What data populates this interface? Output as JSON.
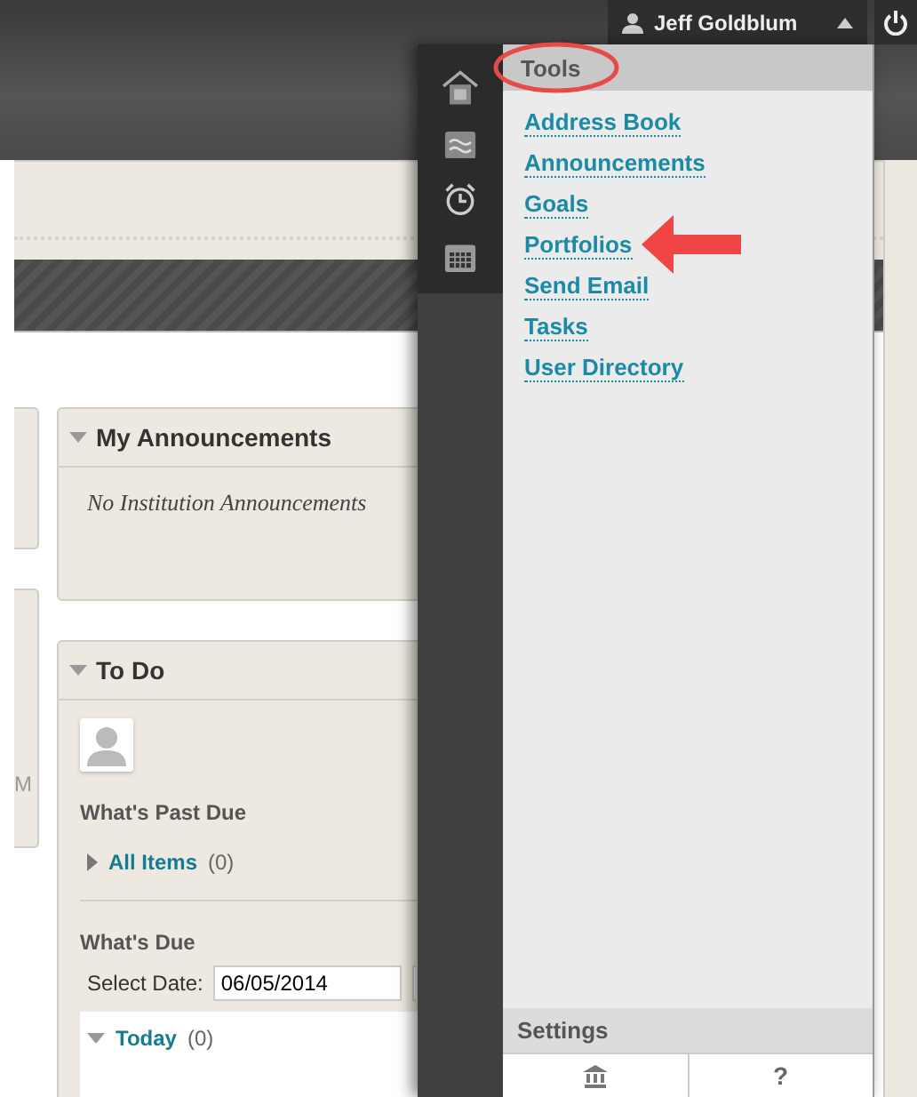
{
  "user": {
    "name": "Jeff Goldblum"
  },
  "left_fragment": "M",
  "announcements": {
    "title": "My Announcements",
    "expanded": true,
    "message": "No Institution Announcements"
  },
  "todo": {
    "title": "To Do",
    "expanded": true,
    "past_due": {
      "title": "What's Past Due",
      "items": [
        {
          "label": "All Items",
          "count": "(0)",
          "expanded": false
        }
      ]
    },
    "due": {
      "title": "What's Due",
      "date_label": "Select Date:",
      "date_value": "06/05/2014",
      "groups": [
        {
          "label": "Today",
          "count": "(0)",
          "expanded": true
        }
      ]
    }
  },
  "menu": {
    "title": "Tools",
    "items": [
      {
        "label": "Address Book"
      },
      {
        "label": "Announcements"
      },
      {
        "label": "Goals"
      },
      {
        "label": "Portfolios"
      },
      {
        "label": "Send Email"
      },
      {
        "label": "Tasks"
      },
      {
        "label": "User Directory"
      }
    ],
    "settings_title": "Settings",
    "help_label": "?"
  }
}
